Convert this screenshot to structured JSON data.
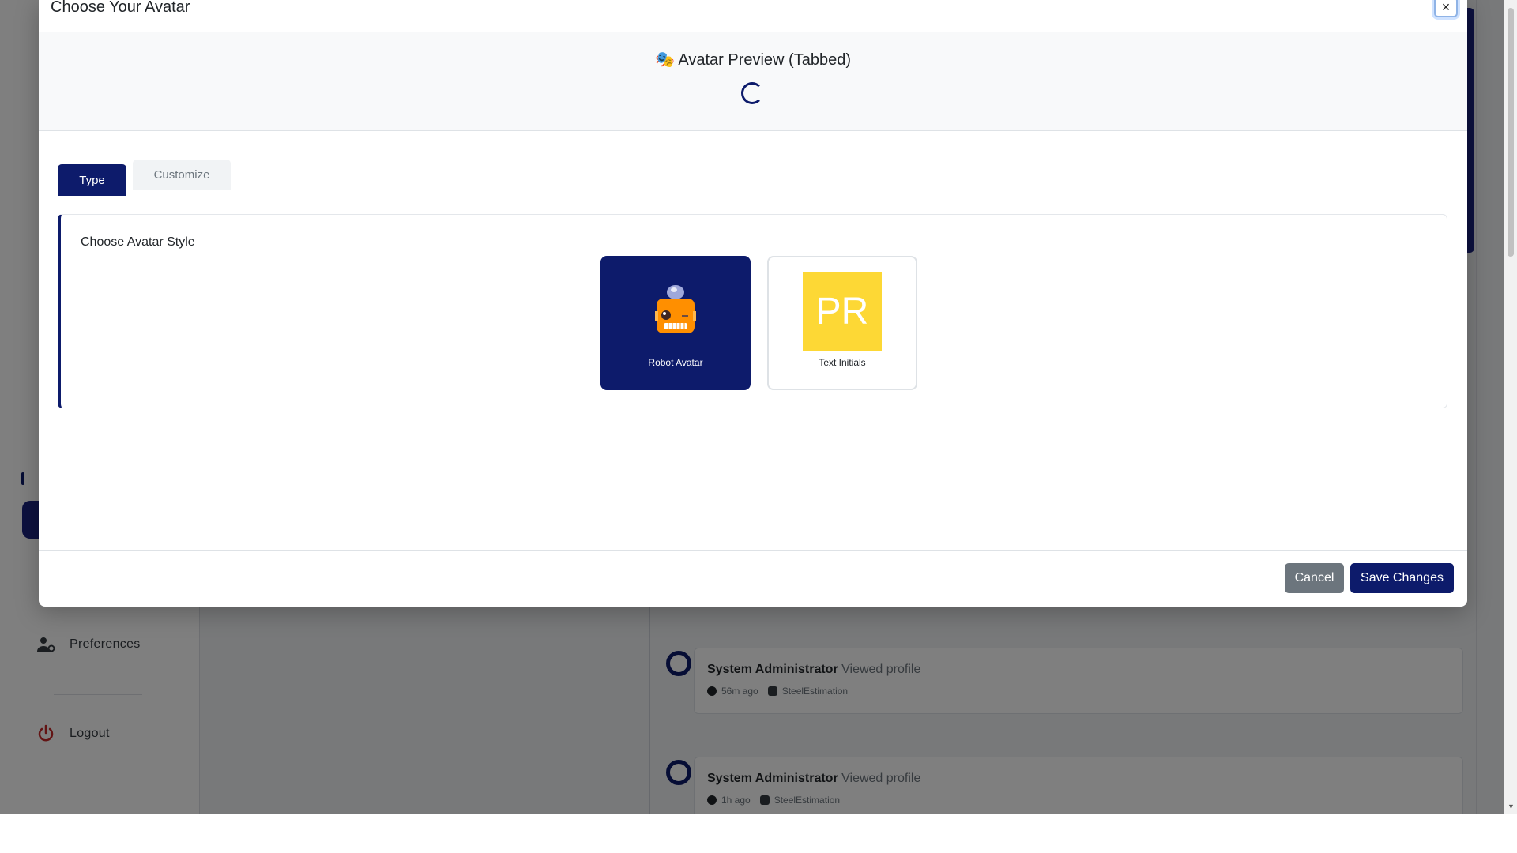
{
  "modal": {
    "title": "Choose Your Avatar",
    "close_label": "×",
    "preview_title": "🎭 Avatar Preview (Tabbed)",
    "tabs": [
      {
        "label": "Type",
        "active": true
      },
      {
        "label": "Customize",
        "active": false
      }
    ],
    "style_section": {
      "heading": "Choose Avatar Style",
      "options": [
        {
          "label": "Robot Avatar",
          "selected": true,
          "icon": "robot-icon"
        },
        {
          "label": "Text Initials",
          "selected": false,
          "initials": "PR",
          "color": "#fdd835"
        }
      ]
    },
    "footer": {
      "cancel_label": "Cancel",
      "save_label": "Save Changes"
    }
  },
  "background": {
    "sidebar": {
      "items": [
        {
          "label": "Preferences",
          "icon": "user-gear-icon"
        },
        {
          "label": "Logout",
          "icon": "power-icon"
        }
      ]
    },
    "activity": [
      {
        "user": "System Administrator",
        "action": "Viewed profile",
        "time": "56m ago",
        "app": "SteelEstimation"
      },
      {
        "user": "System Administrator",
        "action": "Viewed profile",
        "time": "1h ago",
        "app": "SteelEstimation"
      }
    ]
  },
  "colors": {
    "primary": "#0d1b6b",
    "secondary_button": "#6c757d",
    "initials_bg": "#fdd835"
  }
}
